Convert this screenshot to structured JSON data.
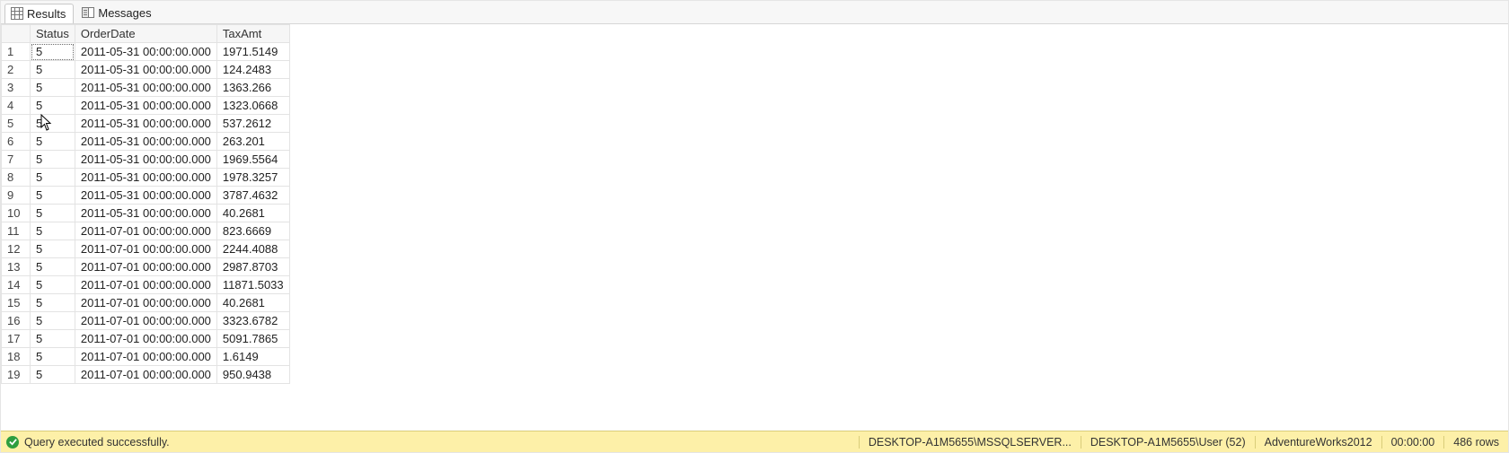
{
  "tabs": {
    "results": "Results",
    "messages": "Messages",
    "active": "results"
  },
  "columns": [
    "Status",
    "OrderDate",
    "TaxAmt"
  ],
  "rows": [
    {
      "n": 1,
      "status": "5",
      "orderdate": "2011-05-31 00:00:00.000",
      "taxamt": "1971.5149"
    },
    {
      "n": 2,
      "status": "5",
      "orderdate": "2011-05-31 00:00:00.000",
      "taxamt": "124.2483"
    },
    {
      "n": 3,
      "status": "5",
      "orderdate": "2011-05-31 00:00:00.000",
      "taxamt": "1363.266"
    },
    {
      "n": 4,
      "status": "5",
      "orderdate": "2011-05-31 00:00:00.000",
      "taxamt": "1323.0668"
    },
    {
      "n": 5,
      "status": "5",
      "orderdate": "2011-05-31 00:00:00.000",
      "taxamt": "537.2612"
    },
    {
      "n": 6,
      "status": "5",
      "orderdate": "2011-05-31 00:00:00.000",
      "taxamt": "263.201"
    },
    {
      "n": 7,
      "status": "5",
      "orderdate": "2011-05-31 00:00:00.000",
      "taxamt": "1969.5564"
    },
    {
      "n": 8,
      "status": "5",
      "orderdate": "2011-05-31 00:00:00.000",
      "taxamt": "1978.3257"
    },
    {
      "n": 9,
      "status": "5",
      "orderdate": "2011-05-31 00:00:00.000",
      "taxamt": "3787.4632"
    },
    {
      "n": 10,
      "status": "5",
      "orderdate": "2011-05-31 00:00:00.000",
      "taxamt": "40.2681"
    },
    {
      "n": 11,
      "status": "5",
      "orderdate": "2011-07-01 00:00:00.000",
      "taxamt": "823.6669"
    },
    {
      "n": 12,
      "status": "5",
      "orderdate": "2011-07-01 00:00:00.000",
      "taxamt": "2244.4088"
    },
    {
      "n": 13,
      "status": "5",
      "orderdate": "2011-07-01 00:00:00.000",
      "taxamt": "2987.8703"
    },
    {
      "n": 14,
      "status": "5",
      "orderdate": "2011-07-01 00:00:00.000",
      "taxamt": "11871.5033"
    },
    {
      "n": 15,
      "status": "5",
      "orderdate": "2011-07-01 00:00:00.000",
      "taxamt": "40.2681"
    },
    {
      "n": 16,
      "status": "5",
      "orderdate": "2011-07-01 00:00:00.000",
      "taxamt": "3323.6782"
    },
    {
      "n": 17,
      "status": "5",
      "orderdate": "2011-07-01 00:00:00.000",
      "taxamt": "5091.7865"
    },
    {
      "n": 18,
      "status": "5",
      "orderdate": "2011-07-01 00:00:00.000",
      "taxamt": "1.6149"
    },
    {
      "n": 19,
      "status": "5",
      "orderdate": "2011-07-01 00:00:00.000",
      "taxamt": "950.9438"
    }
  ],
  "selected_cell": {
    "row": 1,
    "col": "status"
  },
  "status": {
    "message": "Query executed successfully.",
    "server": "DESKTOP-A1M5655\\MSSQLSERVER...",
    "login": "DESKTOP-A1M5655\\User (52)",
    "database": "AdventureWorks2012",
    "elapsed": "00:00:00",
    "rowcount": "486 rows"
  }
}
